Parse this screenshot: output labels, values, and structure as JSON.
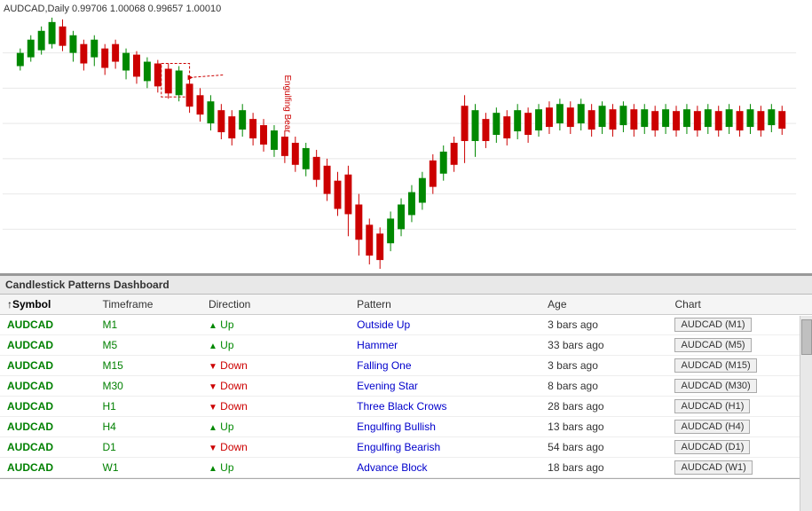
{
  "chart": {
    "title": "AUDCAD,Daily  0.99706 1.00068 0.99657 1.00010",
    "annotation": "Engulfing Bear"
  },
  "dashboard": {
    "title": "Candlestick Patterns Dashboard",
    "columns": [
      {
        "id": "symbol",
        "label": "↑Symbol",
        "sort": true
      },
      {
        "id": "timeframe",
        "label": "Timeframe"
      },
      {
        "id": "direction",
        "label": "Direction"
      },
      {
        "id": "pattern",
        "label": "Pattern"
      },
      {
        "id": "age",
        "label": "Age"
      },
      {
        "id": "chart",
        "label": "Chart"
      }
    ],
    "rows": [
      {
        "symbol": "AUDCAD",
        "timeframe": "M1",
        "direction": "Up",
        "pattern": "Outside Up",
        "age": "3 bars ago",
        "chart_label": "AUDCAD (M1)"
      },
      {
        "symbol": "AUDCAD",
        "timeframe": "M5",
        "direction": "Up",
        "pattern": "Hammer",
        "age": "33 bars ago",
        "chart_label": "AUDCAD (M5)"
      },
      {
        "symbol": "AUDCAD",
        "timeframe": "M15",
        "direction": "Down",
        "pattern": "Falling One",
        "age": "3 bars ago",
        "chart_label": "AUDCAD (M15)"
      },
      {
        "symbol": "AUDCAD",
        "timeframe": "M30",
        "direction": "Down",
        "pattern": "Evening Star",
        "age": "8 bars ago",
        "chart_label": "AUDCAD (M30)"
      },
      {
        "symbol": "AUDCAD",
        "timeframe": "H1",
        "direction": "Down",
        "pattern": "Three Black Crows",
        "age": "28 bars ago",
        "chart_label": "AUDCAD (H1)"
      },
      {
        "symbol": "AUDCAD",
        "timeframe": "H4",
        "direction": "Up",
        "pattern": "Engulfing Bullish",
        "age": "13 bars ago",
        "chart_label": "AUDCAD (H4)"
      },
      {
        "symbol": "AUDCAD",
        "timeframe": "D1",
        "direction": "Down",
        "pattern": "Engulfing Bearish",
        "age": "54 bars ago",
        "chart_label": "AUDCAD (D1)"
      },
      {
        "symbol": "AUDCAD",
        "timeframe": "W1",
        "direction": "Up",
        "pattern": "Advance Block",
        "age": "18 bars ago",
        "chart_label": "AUDCAD (W1)"
      }
    ]
  }
}
